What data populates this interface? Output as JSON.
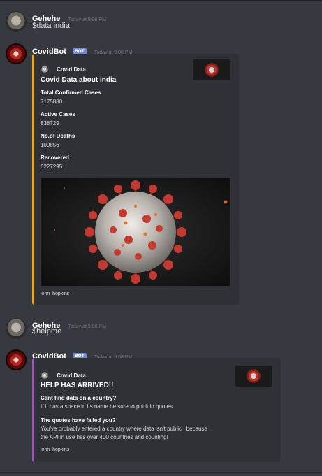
{
  "messages": [
    {
      "user": "Gehehe",
      "timestamp": "Today at 9:08 PM",
      "text": "$data india"
    },
    {
      "user": "CovidBot",
      "badge": "BOT",
      "timestamp": "Today at 9:08 PM",
      "embed": {
        "author": "Covid Data",
        "title": "Covid Data about india",
        "fields": [
          {
            "name": "Total Confirmed Cases",
            "value": "7175880"
          },
          {
            "name": "Active Cases",
            "value": "838729"
          },
          {
            "name": "No.of Deaths",
            "value": "109856"
          },
          {
            "name": "Recovered",
            "value": "6227295"
          }
        ],
        "footer": "john_hopkins",
        "accent_color": "#f1a614"
      }
    },
    {
      "user": "Gehehe",
      "timestamp": "Today at 9:08 PM",
      "text": "$helpme"
    },
    {
      "user": "CovidBot",
      "badge": "BOT",
      "timestamp": "Today at 9:08 PM",
      "embed": {
        "author": "Covid Data",
        "title": "HELP HAS ARRIVED!!",
        "fields": [
          {
            "name": "Cant find data on a country?",
            "value": "If it has a space in its name be sure to put it in quotes"
          },
          {
            "name": "The quotes have failed you?",
            "value_lines": [
              "You've probably entered a country where data isn't public , because",
              "the API in use has over 400 countries and counting!"
            ]
          }
        ],
        "footer": "john_hopkins",
        "accent_color": "#9b59b6"
      }
    }
  ],
  "icons": {
    "user_avatar": "user-avatar-icon",
    "bot_avatar": "virus-avatar-icon",
    "embed_author": "covid-data-icon"
  },
  "colors": {
    "background": "#36393f",
    "embed_background": "#2f3136",
    "bot_badge": "#7289da",
    "timestamp": "#72767d"
  }
}
